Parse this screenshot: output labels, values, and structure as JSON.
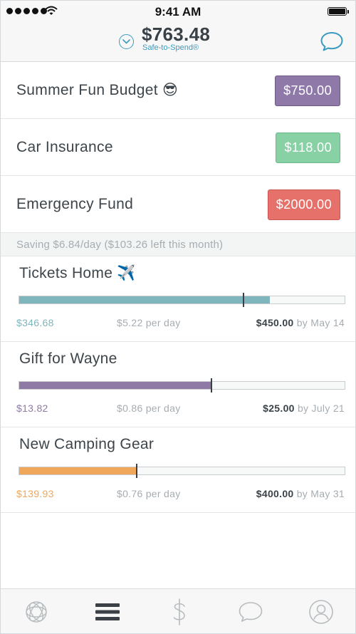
{
  "status_bar": {
    "time": "9:41 AM"
  },
  "header": {
    "amount": "$763.48",
    "label": "Safe-to-Spend®"
  },
  "envelopes": [
    {
      "name": "Summer Fun Budget 😎",
      "amount": "$750.00",
      "color": "#8e79a8",
      "border": "#6e5a88"
    },
    {
      "name": "Car Insurance",
      "amount": "$118.00",
      "color": "#88d1a4",
      "border": "#6bb888"
    },
    {
      "name": "Emergency Fund",
      "amount": "$2000.00",
      "color": "#e5716a",
      "border": "#c8554f"
    }
  ],
  "savings_banner": "Saving $6.84/day ($103.26 left this month)",
  "goals": [
    {
      "name": "Tickets Home ✈️",
      "saved": "$346.68",
      "per_day": "$5.22 per day",
      "target": "$450.00",
      "by": "by May 14",
      "progress": 0.77,
      "expected": 0.69,
      "color": "#7fb5bd"
    },
    {
      "name": "Gift for Wayne",
      "saved": "$13.82",
      "per_day": "$0.86 per day",
      "target": "$25.00",
      "by": "by July 21",
      "progress": 0.59,
      "expected": 0.59,
      "color": "#8f7aa6"
    },
    {
      "name": "New Camping Gear",
      "saved": "$139.93",
      "per_day": "$0.76 per day",
      "target": "$400.00",
      "by": "by May 31",
      "progress": 0.36,
      "expected": 0.36,
      "color": "#f0a75a"
    }
  ],
  "tabs": [
    {
      "icon": "overview-icon",
      "active": false
    },
    {
      "icon": "list-icon",
      "active": true
    },
    {
      "icon": "dollar-icon",
      "active": false
    },
    {
      "icon": "chat-icon",
      "active": false
    },
    {
      "icon": "profile-icon",
      "active": false
    }
  ]
}
